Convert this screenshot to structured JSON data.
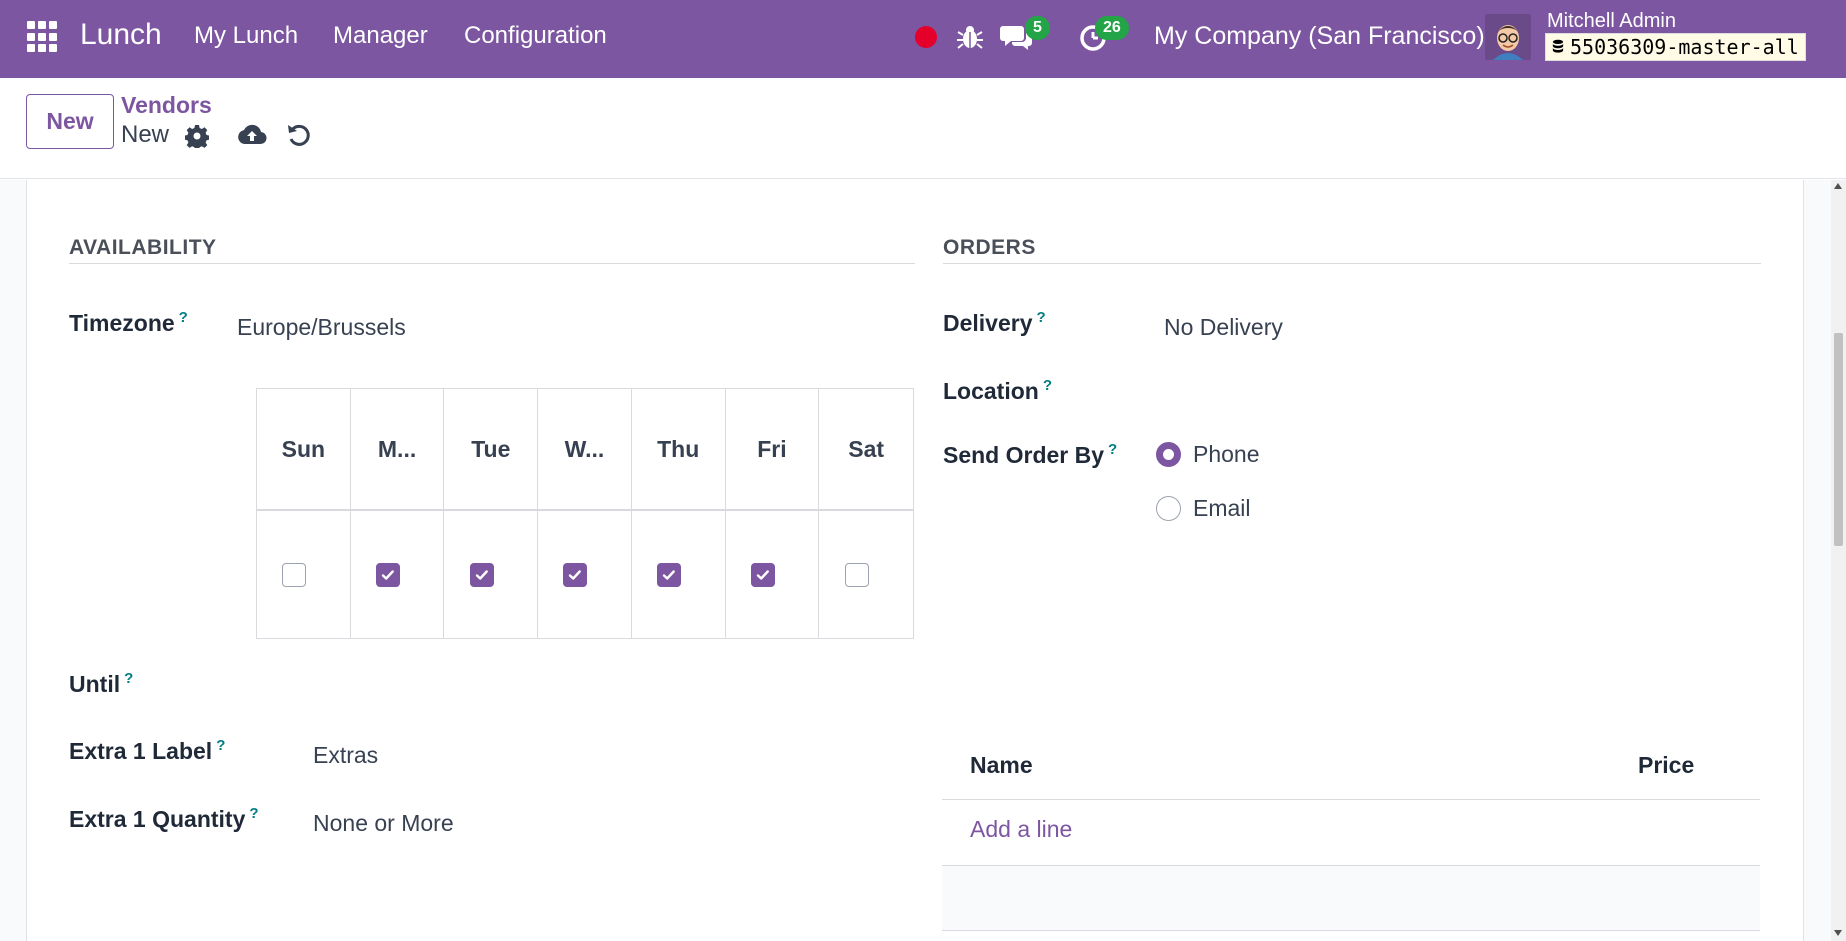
{
  "navbar": {
    "app_name": "Lunch",
    "menu": [
      "My Lunch",
      "Manager",
      "Configuration"
    ],
    "messages_count": "5",
    "activities_count": "26",
    "company": "My Company (San Francisco)",
    "user_name": "Mitchell Admin",
    "database": "55036309-master-all",
    "colors": {
      "brand": "#7c56a0",
      "badge": "#22a447",
      "record": "#e4002b"
    }
  },
  "control": {
    "new_button": "New",
    "breadcrumb_parent": "Vendors",
    "breadcrumb_current": "New"
  },
  "availability": {
    "title": "AVAILABILITY",
    "timezone_label": "Timezone",
    "timezone_value": "Europe/Brussels",
    "days": [
      {
        "label": "Sun",
        "checked": false
      },
      {
        "label": "M...",
        "checked": true
      },
      {
        "label": "Tue",
        "checked": true
      },
      {
        "label": "W...",
        "checked": true
      },
      {
        "label": "Thu",
        "checked": true
      },
      {
        "label": "Fri",
        "checked": true
      },
      {
        "label": "Sat",
        "checked": false
      }
    ],
    "until_label": "Until",
    "extra1_label_label": "Extra 1 Label",
    "extra1_label_value": "Extras",
    "extra1_qty_label": "Extra 1 Quantity",
    "extra1_qty_value": "None or More"
  },
  "orders": {
    "title": "ORDERS",
    "delivery_label": "Delivery",
    "delivery_value": "No Delivery",
    "location_label": "Location",
    "send_order_label": "Send Order By",
    "send_options": [
      {
        "label": "Phone",
        "selected": true
      },
      {
        "label": "Email",
        "selected": false
      }
    ]
  },
  "extras_table": {
    "col_name": "Name",
    "col_price": "Price",
    "add_line": "Add a line"
  },
  "help_mark": "?"
}
